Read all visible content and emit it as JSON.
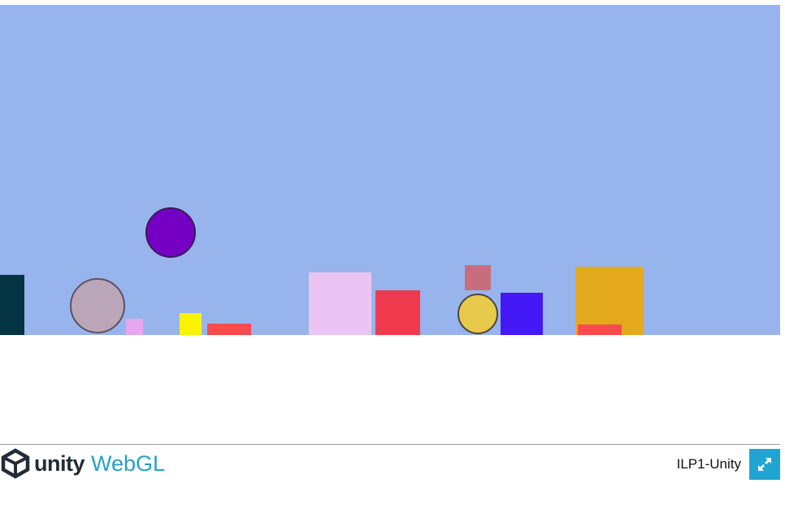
{
  "game": {
    "sky_color": "#97b5ec",
    "shapes": [
      {
        "name": "dark-teal-block",
        "kind": "rect",
        "color": "#053545"
      },
      {
        "name": "mauve-ball",
        "kind": "circle",
        "color": "#bba6b9"
      },
      {
        "name": "purple-ball",
        "kind": "circle",
        "color": "#7500c3"
      },
      {
        "name": "small-pink-block",
        "kind": "rect",
        "color": "#e7a6f0"
      },
      {
        "name": "small-yellow-block",
        "kind": "rect",
        "color": "#fbf300"
      },
      {
        "name": "red-slab",
        "kind": "rect",
        "color": "#f74d4c"
      },
      {
        "name": "lavender-block",
        "kind": "rect",
        "color": "#ecc4f4"
      },
      {
        "name": "crimson-block",
        "kind": "rect",
        "color": "#ef3a4e"
      },
      {
        "name": "dusty-rose-block",
        "kind": "rect",
        "color": "#c76e7e"
      },
      {
        "name": "yellow-ball",
        "kind": "circle",
        "color": "#e7c94b"
      },
      {
        "name": "blue-block",
        "kind": "rect",
        "color": "#4319f5"
      },
      {
        "name": "orange-block",
        "kind": "rect",
        "color": "#e5a920"
      },
      {
        "name": "red-slab-2",
        "kind": "rect",
        "color": "#f74d4c"
      }
    ]
  },
  "footer": {
    "logo_unity": "unity",
    "logo_webgl": "WebGL",
    "build_title": "ILP1-Unity",
    "logo_icon": "unity-cube-icon",
    "fullscreen_icon": "fullscreen-expand-icon",
    "accent": "#20a5d2"
  }
}
